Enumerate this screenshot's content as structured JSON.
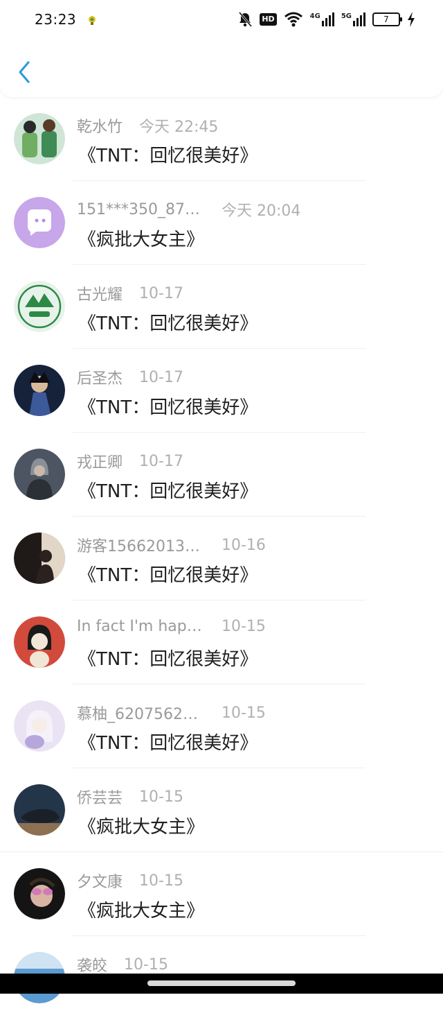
{
  "status_bar": {
    "time": "23:23",
    "hd_label": "HD",
    "net1_label": "4G",
    "net2_label": "5G",
    "battery": "7"
  },
  "list": [
    {
      "name": "乾水竹",
      "date": "今天 22:45",
      "title": "《TNT：回忆很美好》",
      "avatar_colors": [
        "#cfe6d7",
        "#6fae63"
      ]
    },
    {
      "name": "151***350_875...",
      "date": "今天 20:04",
      "title": "《疯批大女主》",
      "avatar_colors": [
        "#c7a6ea",
        "#b18ce3"
      ]
    },
    {
      "name": "古光耀",
      "date": "10-17",
      "title": "《TNT：回忆很美好》",
      "avatar_colors": [
        "#e7f3ea",
        "#2d8a46"
      ]
    },
    {
      "name": "后圣杰",
      "date": "10-17",
      "title": "《TNT：回忆很美好》",
      "avatar_colors": [
        "#16213a",
        "#3c5a9a"
      ]
    },
    {
      "name": "戎正卿",
      "date": "10-17",
      "title": "《TNT：回忆很美好》",
      "avatar_colors": [
        "#4d5562",
        "#8a8f98"
      ]
    },
    {
      "name": "游客156620133...",
      "date": "10-16",
      "title": "《TNT：回忆很美好》",
      "avatar_colors": [
        "#1f1a18",
        "#e2d6c6"
      ]
    },
    {
      "name": "In fact I'm happ...",
      "date": "10-15",
      "title": "《TNT：回忆很美好》",
      "avatar_colors": [
        "#d24a3c",
        "#f1e6d6"
      ]
    },
    {
      "name": "慕柚_62075620...",
      "date": "10-15",
      "title": "《TNT：回忆很美好》",
      "avatar_colors": [
        "#e9e3f3",
        "#b7a6dc"
      ]
    },
    {
      "name": "侨芸芸",
      "date": "10-15",
      "title": "《疯批大女主》",
      "avatar_colors": [
        "#233549",
        "#8d6f52"
      ]
    },
    {
      "name": "夕文康",
      "date": "10-15",
      "title": "《疯批大女主》",
      "avatar_colors": [
        "#141414",
        "#d27ab7"
      ]
    },
    {
      "name": "袭皎",
      "date": "10-15",
      "title": "",
      "avatar_colors": [
        "#5b9bd1",
        "#cfe3f2"
      ]
    }
  ]
}
